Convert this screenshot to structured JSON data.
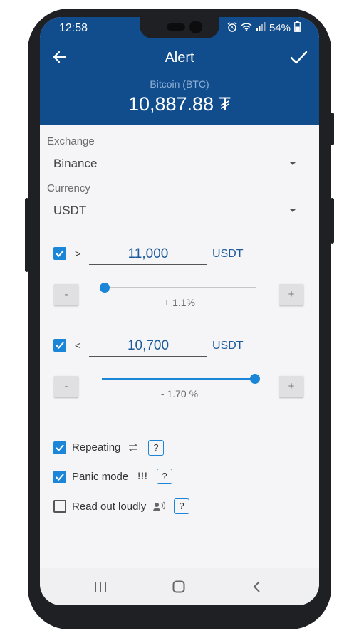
{
  "status_bar": {
    "time": "12:58",
    "battery": "54%"
  },
  "app_bar": {
    "title": "Alert",
    "coin_name": "Bitcoin (BTC)",
    "price": "10,887.88 ₮"
  },
  "exchange": {
    "label": "Exchange",
    "value": "Binance"
  },
  "currency": {
    "label": "Currency",
    "value": "USDT"
  },
  "alerts": [
    {
      "enabled": true,
      "operator": ">",
      "value": "11,000",
      "unit": "USDT",
      "minus": "-",
      "plus": "+",
      "percent": "+ 1.1%",
      "slider_level": 0.02
    },
    {
      "enabled": true,
      "operator": "<",
      "value": "10,700",
      "unit": "USDT",
      "minus": "-",
      "plus": "+",
      "percent": "- 1.70 %",
      "slider_level": 0.99
    }
  ],
  "options": [
    {
      "label": "Repeating",
      "checked": true,
      "icon": "repeat-icon",
      "help": "?"
    },
    {
      "label": "Panic mode",
      "checked": true,
      "icon": "exclamation-icon",
      "icon_text": "!!!",
      "help": "?"
    },
    {
      "label": "Read out loudly",
      "checked": false,
      "icon": "speaker-icon",
      "help": "?"
    }
  ],
  "colors": {
    "primary": "#114c8d",
    "accent": "#1b86d8",
    "background": "#f5f5f7"
  }
}
